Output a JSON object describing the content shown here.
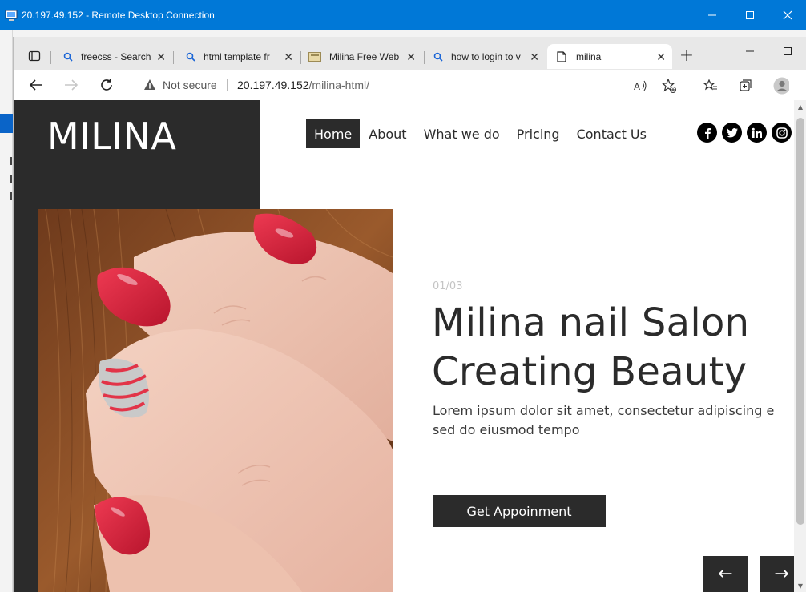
{
  "rdp": {
    "title": "20.197.49.152 - Remote Desktop Connection",
    "controls": [
      "minimize-icon",
      "maximize-icon",
      "close-icon"
    ]
  },
  "browser": {
    "tabs": [
      {
        "title": "freecss - Search",
        "icon": "search-icon",
        "active": false
      },
      {
        "title": "html template fr",
        "icon": "search-icon",
        "active": false
      },
      {
        "title": "Milina Free Web",
        "icon": "page-thumbnail-icon",
        "active": false
      },
      {
        "title": "how to login to v",
        "icon": "search-icon",
        "active": false
      },
      {
        "title": "milina",
        "icon": "document-icon",
        "active": true
      }
    ],
    "new_tab_label": "+",
    "security_label": "Not secure",
    "url_host": "20.197.49.152",
    "url_path": "/milina-html/"
  },
  "site": {
    "logo": "MILINA",
    "menu": [
      {
        "label": "Home",
        "active": true
      },
      {
        "label": "About",
        "active": false
      },
      {
        "label": "What we do",
        "active": false
      },
      {
        "label": "Pricing",
        "active": false
      },
      {
        "label": "Contact Us",
        "active": false
      }
    ],
    "socials": [
      "facebook-icon",
      "twitter-icon",
      "linkedin-icon",
      "instagram-icon"
    ],
    "hero": {
      "counter": "01/03",
      "headline_line1": "Milina nail Salon",
      "headline_line2": "Creating Beauty",
      "subtext_line1": "Lorem ipsum dolor sit amet, consectetur adipiscing e",
      "subtext_line2": "sed do eiusmod tempo",
      "cta_label": "Get Appoinment",
      "prev_label": "←",
      "next_label": "→"
    },
    "colors": {
      "dark": "#2b2b2b",
      "nail_red": "#d91f3a",
      "hair": "#8a4a22"
    }
  }
}
